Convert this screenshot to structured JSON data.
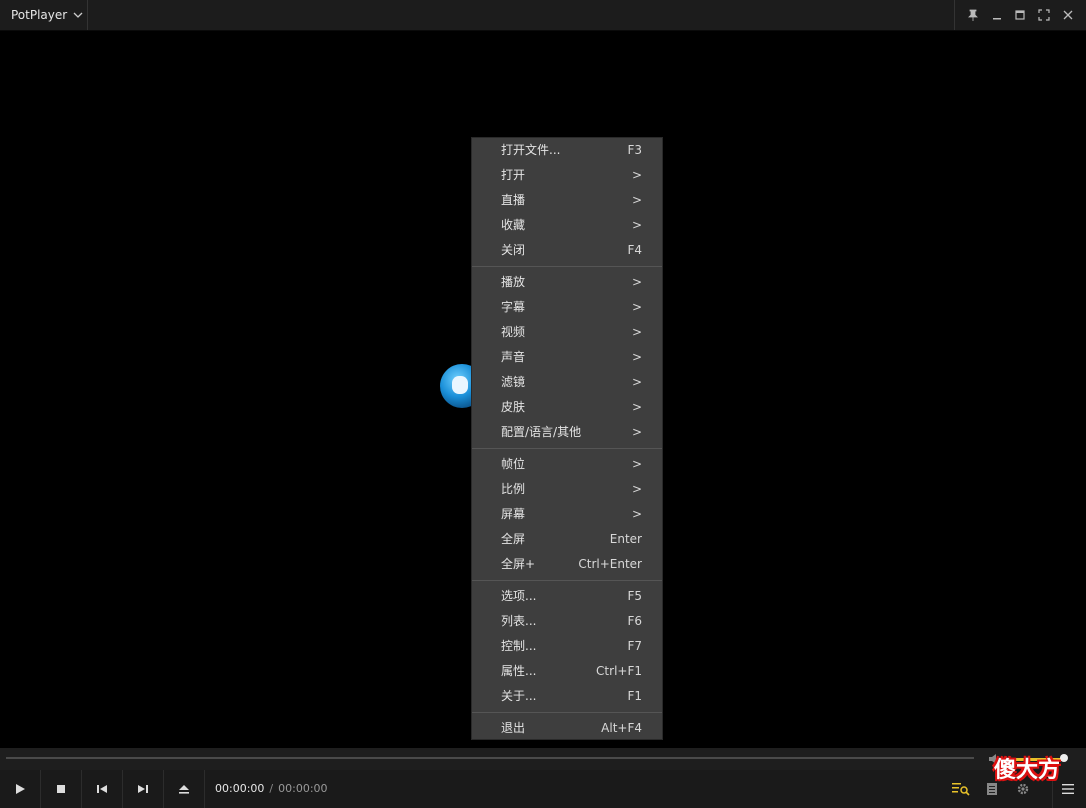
{
  "app": {
    "title": "PotPlayer"
  },
  "context_menu": {
    "groups": [
      [
        {
          "label": "打开文件...",
          "shortcut": "F3"
        },
        {
          "label": "打开",
          "shortcut": ">"
        },
        {
          "label": "直播",
          "shortcut": ">"
        },
        {
          "label": "收藏",
          "shortcut": ">"
        },
        {
          "label": "关闭",
          "shortcut": "F4"
        }
      ],
      [
        {
          "label": "播放",
          "shortcut": ">"
        },
        {
          "label": "字幕",
          "shortcut": ">"
        },
        {
          "label": "视频",
          "shortcut": ">"
        },
        {
          "label": "声音",
          "shortcut": ">"
        },
        {
          "label": "滤镜",
          "shortcut": ">"
        },
        {
          "label": "皮肤",
          "shortcut": ">"
        },
        {
          "label": "配置/语言/其他",
          "shortcut": ">"
        }
      ],
      [
        {
          "label": "帧位",
          "shortcut": ">"
        },
        {
          "label": "比例",
          "shortcut": ">"
        },
        {
          "label": "屏幕",
          "shortcut": ">"
        },
        {
          "label": "全屏",
          "shortcut": "Enter"
        },
        {
          "label": "全屏+",
          "shortcut": "Ctrl+Enter"
        }
      ],
      [
        {
          "label": "选项...",
          "shortcut": "F5"
        },
        {
          "label": "列表...",
          "shortcut": "F6"
        },
        {
          "label": "控制...",
          "shortcut": "F7"
        },
        {
          "label": "属性...",
          "shortcut": "Ctrl+F1"
        },
        {
          "label": "关于...",
          "shortcut": "F1"
        }
      ],
      [
        {
          "label": "退出",
          "shortcut": "Alt+F4"
        }
      ]
    ]
  },
  "playback": {
    "current_time": "00:00:00",
    "separator": "/",
    "duration": "00:00:00"
  },
  "volume": {
    "level": 0.85
  },
  "watermark": {
    "text": "傻大方"
  },
  "colors": {
    "accent": "#e8c22a",
    "menu_bg": "#3e3e3e",
    "bar_bg": "#1a1a1a"
  }
}
